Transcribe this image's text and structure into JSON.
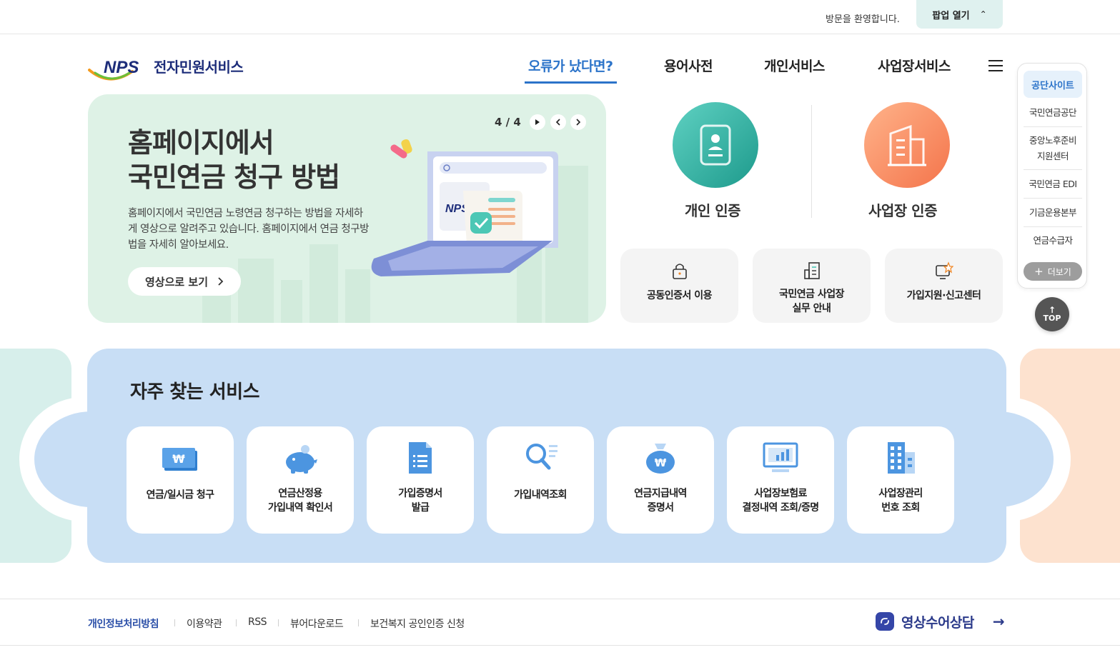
{
  "topbar": {
    "welcome": "방문을 환영합니다.",
    "popup_label": "팝업 열기",
    "popup_chevron": "^"
  },
  "header": {
    "logo_mark": "NPS",
    "logo_text": "전자민원서비스",
    "nav": [
      {
        "label": "오류가 났다면?"
      },
      {
        "label": "용어사전"
      },
      {
        "label": "개인서비스"
      },
      {
        "label": "사업장서비스"
      }
    ]
  },
  "hero": {
    "title_line1": "홈페이지에서",
    "title_line2": "국민연금 청구 방법",
    "desc": "홈페이지에서 국민연금 노령연금 청구하는 방법을 자세하게 영상으로 알려주고 있습니다. 홈페이지에서 연금 청구방법을 자세히 알아보세요.",
    "button_label": "영상으로 보기",
    "counter": "4 / 4",
    "illust_mark": "NPS"
  },
  "auth": {
    "personal_label": "개인 인증",
    "business_label": "사업장 인증"
  },
  "quick_cards": [
    {
      "line1": "공동인증서 이용",
      "line2": ""
    },
    {
      "line1": "국민연금 사업장",
      "line2": "실무 안내"
    },
    {
      "line1": "가입지원·신고센터",
      "line2": ""
    }
  ],
  "side_menu": {
    "head": "공단사이트",
    "items": [
      "국민연금공단",
      "중앙노후준비",
      "지원센터",
      "국민연금 EDI",
      "기금운용본부",
      "연금수급자"
    ],
    "more_label": "더보기",
    "top_label": "TOP"
  },
  "services": {
    "title": "자주 찾는 서비스",
    "items": [
      {
        "line1": "연금/일시금 청구",
        "line2": ""
      },
      {
        "line1": "연금산정용",
        "line2": "가입내역 확인서"
      },
      {
        "line1": "가입증명서",
        "line2": "발급"
      },
      {
        "line1": "가입내역조회",
        "line2": ""
      },
      {
        "line1": "연금지급내역",
        "line2": "증명서"
      },
      {
        "line1": "사업장보험료",
        "line2": "결정내역 조회/증명"
      },
      {
        "line1": "사업장관리",
        "line2": "번호 조회"
      }
    ]
  },
  "footer": {
    "links": [
      "개인정보처리방침",
      "이용약관",
      "RSS",
      "뷰어다운로드",
      "보건복지 공인인증 신청"
    ],
    "video_consult": "영상수어상담"
  },
  "colors": {
    "accent": "#2b73c9",
    "hero_bg": "#def2e6",
    "service_bg": "#c8def5",
    "personal": "#1d9a8c",
    "business": "#f4744b"
  }
}
